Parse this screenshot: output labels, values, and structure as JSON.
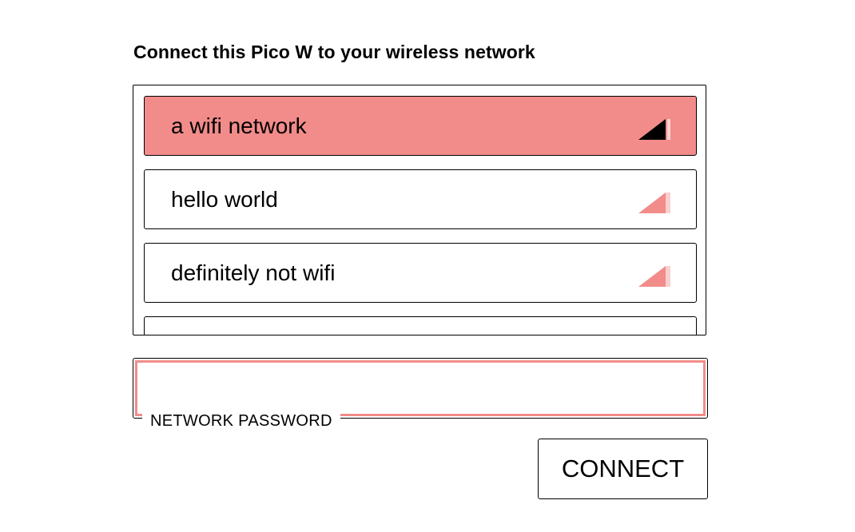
{
  "title": "Connect this Pico W to your wireless network",
  "colors": {
    "accent": "#f28c8a",
    "accent_light": "#f9d0cf",
    "selected_signal": "#000000"
  },
  "networks": [
    {
      "name": "a wifi network",
      "selected": true,
      "signal_icon": "signal-strong-icon"
    },
    {
      "name": "hello world",
      "selected": false,
      "signal_icon": "signal-medium-icon"
    },
    {
      "name": "definitely not wifi",
      "selected": false,
      "signal_icon": "signal-medium-icon"
    },
    {
      "name": "",
      "selected": false,
      "signal_icon": ""
    }
  ],
  "password": {
    "label": "NETWORK PASSWORD",
    "value": "",
    "placeholder": ""
  },
  "connect_label": "CONNECT"
}
